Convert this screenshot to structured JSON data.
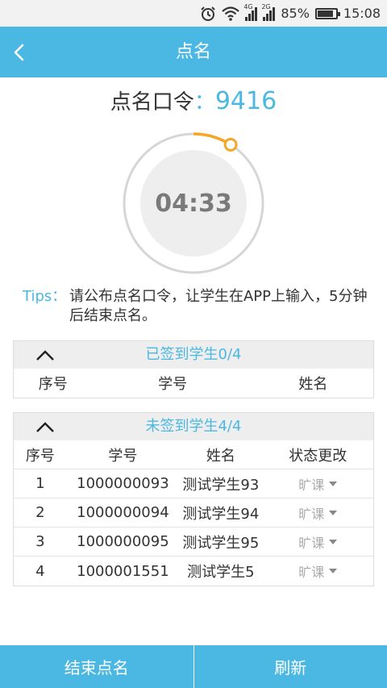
{
  "status_bar": {
    "battery": "85%",
    "time": "15:08",
    "network_primary": "4G",
    "network_secondary": "2G",
    "battery_level": 0.85
  },
  "header": {
    "title": "点名"
  },
  "code": {
    "label": "点名口令",
    "separator": "：",
    "value": "9416"
  },
  "timer": {
    "remaining": "04:33",
    "progress_fraction": 0.09
  },
  "tips": {
    "label": "Tips：",
    "text": "请公布点名口令，让学生在APP上输入，5分钟后结束点名。"
  },
  "signed": {
    "title": "已签到学生0/4",
    "columns": [
      "序号",
      "学号",
      "姓名"
    ],
    "rows": []
  },
  "unsigned": {
    "title": "未签到学生4/4",
    "columns": [
      "序号",
      "学号",
      "姓名",
      "状态更改"
    ],
    "rows": [
      {
        "index": "1",
        "id": "1000000093",
        "name": "测试学生93",
        "status": "旷课"
      },
      {
        "index": "2",
        "id": "1000000094",
        "name": "测试学生94",
        "status": "旷课"
      },
      {
        "index": "3",
        "id": "1000000095",
        "name": "测试学生95",
        "status": "旷课"
      },
      {
        "index": "4",
        "id": "1000001551",
        "name": "测试学生5",
        "status": "旷课"
      }
    ]
  },
  "actions": {
    "end_label": "结束点名",
    "refresh_label": "刷新"
  },
  "colors": {
    "accent": "#4bb8e4",
    "timer_arc": "#f5a623",
    "ring": "#d6d6d6"
  }
}
